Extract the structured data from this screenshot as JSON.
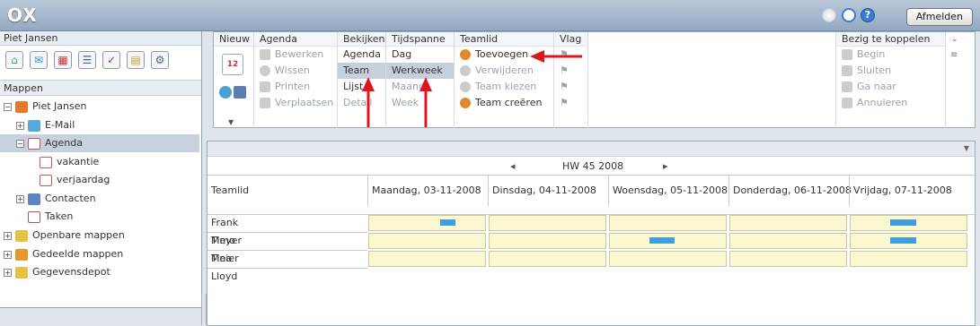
{
  "app": {
    "logo": "OX",
    "logout": "Afmelden"
  },
  "left": {
    "title": "Piet Jansen",
    "mappen": "Mappen",
    "tree": [
      {
        "label": "Piet Jansen",
        "icon": "user-icon"
      },
      {
        "label": "E-Mail",
        "icon": "mail-icon"
      },
      {
        "label": "Agenda",
        "icon": "calendar-icon"
      },
      {
        "label": "vakantie",
        "icon": "calendar-icon"
      },
      {
        "label": "verjaardag",
        "icon": "calendar-icon"
      },
      {
        "label": "Contacten",
        "icon": "contacts-icon"
      },
      {
        "label": "Taken",
        "icon": "tasks-icon"
      },
      {
        "label": "Openbare mappen",
        "icon": "public-folder-icon"
      },
      {
        "label": "Gedeelde mappen",
        "icon": "shared-folder-icon"
      },
      {
        "label": "Gegevensdepot",
        "icon": "infostore-icon"
      }
    ]
  },
  "toolbar": {
    "nieuw": "Nieuw",
    "agenda": {
      "title": "Agenda",
      "items": [
        "Bewerken",
        "Wissen",
        "Printen",
        "Verplaatsen"
      ]
    },
    "bekijken": {
      "title": "Bekijken",
      "items": [
        "Agenda",
        "Team",
        "Lijst",
        "Detail"
      ]
    },
    "tijdspanne": {
      "title": "Tijdspanne",
      "items": [
        "Dag",
        "Werkweek",
        "Maand",
        "Week"
      ]
    },
    "teamlid": {
      "title": "Teamlid",
      "items": [
        "Toevoegen",
        "Verwijderen",
        "Team kiezen",
        "Team creëren"
      ]
    },
    "vlag": {
      "title": "Vlag"
    },
    "bezig": {
      "title": "Bezig te koppelen",
      "items": [
        "Begin",
        "Sluiten",
        "Ga naar",
        "Annuleren"
      ]
    }
  },
  "calendar": {
    "week": "HW 45 2008",
    "prev": "◂",
    "next": "▸",
    "teamlid_header": "Teamlid",
    "days": [
      "Maandag, 03-11-2008",
      "Dinsdag, 04-11-2008",
      "Woensdag, 05-11-2008",
      "Donderdag, 06-11-2008",
      "Vrijdag, 07-11-2008"
    ],
    "members": [
      "Frank Meyer",
      "Timo Meier",
      "Tina Lloyd"
    ]
  },
  "colors": {
    "accent": "#3d9ee0",
    "arrow": "#e0151b",
    "cell": "#fbf7cf"
  }
}
